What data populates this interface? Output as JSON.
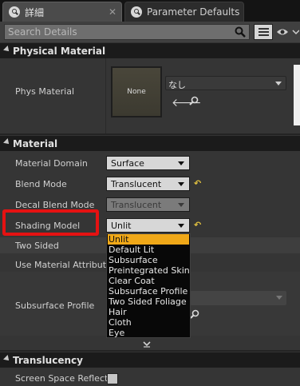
{
  "tabs": [
    {
      "label": "詳細",
      "close": "✕"
    },
    {
      "label": "Parameter Defaults"
    }
  ],
  "search": {
    "placeholder": "Search Details"
  },
  "sections": {
    "physical_material": {
      "title": "Physical Material",
      "phys_material_label": "Phys Material",
      "thumbnail_text": "None",
      "asset_value": "なし"
    },
    "material": {
      "title": "Material",
      "rows": [
        {
          "label": "Material Domain",
          "value": "Surface"
        },
        {
          "label": "Blend Mode",
          "value": "Translucent"
        },
        {
          "label": "Decal Blend Mode",
          "value": "Translucent"
        },
        {
          "label": "Shading Model",
          "value": "Unlit"
        },
        {
          "label": "Two Sided"
        },
        {
          "label": "Use Material Attribute"
        },
        {
          "label": "Subsurface Profile"
        }
      ],
      "reset_symbol": "↶"
    },
    "translucency": {
      "title": "Translucency",
      "rows": [
        {
          "label": "Screen Space Reflecti"
        }
      ]
    }
  },
  "dropdown": {
    "selected": "Unlit",
    "options": [
      "Unlit",
      "Default Lit",
      "Subsurface",
      "Preintegrated Skin",
      "Clear Coat",
      "Subsurface Profile",
      "Two Sided Foliage",
      "Hair",
      "Cloth",
      "Eye"
    ]
  },
  "icons": {
    "tab": "search-icon",
    "close": "close-icon",
    "search": "magnifier-icon",
    "view": "list-view-icon",
    "visibility": "eye-icon",
    "use_selected": "left-arrow-icon",
    "browse": "magnifier-icon"
  },
  "colors": {
    "highlight": "#e51212",
    "selected_option": "#f0a818",
    "reset_arrow": "#e0c040"
  }
}
